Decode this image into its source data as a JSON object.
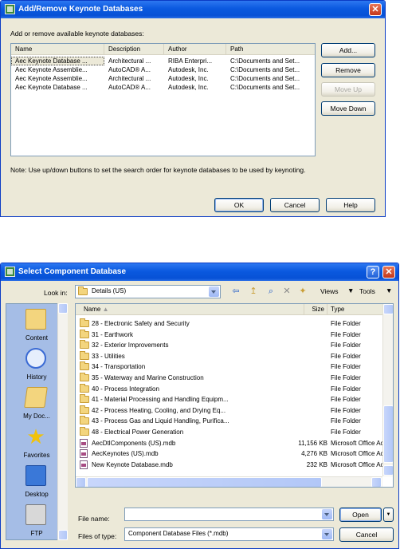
{
  "dialog1": {
    "title": "Add/Remove Keynote Databases",
    "instruction": "Add or remove available keynote databases:",
    "columns": [
      "Name",
      "Description",
      "Author",
      "Path"
    ],
    "rows": [
      [
        "Aec Keynote Database ...",
        "Architectural ...",
        "RIBA Enterpri...",
        "C:\\Documents and Set..."
      ],
      [
        "Aec Keynote Assemblie...",
        "AutoCAD® A...",
        "Autodesk, Inc.",
        "C:\\Documents and Set..."
      ],
      [
        "Aec Keynote Assemblie...",
        "Architectural ...",
        "Autodesk, Inc.",
        "C:\\Documents and Set..."
      ],
      [
        "Aec Keynote Database ...",
        "AutoCAD® A...",
        "Autodesk, Inc.",
        "C:\\Documents and Set..."
      ]
    ],
    "buttons": {
      "add": "Add...",
      "remove": "Remove",
      "move_up": "Move Up",
      "move_down": "Move Down",
      "ok": "OK",
      "cancel": "Cancel",
      "help": "Help"
    },
    "note": "Note: Use up/down buttons to set the search order for keynote databases to be used by keynoting."
  },
  "dialog2": {
    "title": "Select Component Database",
    "look_in_label": "Look in:",
    "look_in_value": "Details (US)",
    "views_label": "Views",
    "tools_label": "Tools",
    "places": [
      "Content",
      "History",
      "My Doc...",
      "Favorites",
      "Desktop",
      "FTP"
    ],
    "columns": [
      "Name",
      "Size",
      "Type"
    ],
    "files": [
      {
        "name": "28 - Electronic Safety and Security",
        "size": "",
        "type": "File Folder",
        "kind": "folder"
      },
      {
        "name": "31 - Earthwork",
        "size": "",
        "type": "File Folder",
        "kind": "folder"
      },
      {
        "name": "32 - Exterior Improvements",
        "size": "",
        "type": "File Folder",
        "kind": "folder"
      },
      {
        "name": "33 - Utilities",
        "size": "",
        "type": "File Folder",
        "kind": "folder"
      },
      {
        "name": "34 - Transportation",
        "size": "",
        "type": "File Folder",
        "kind": "folder"
      },
      {
        "name": "35 - Waterway and Marine Construction",
        "size": "",
        "type": "File Folder",
        "kind": "folder"
      },
      {
        "name": "40 - Process Integration",
        "size": "",
        "type": "File Folder",
        "kind": "folder"
      },
      {
        "name": "41 - Material Processing and Handling Equipm...",
        "size": "",
        "type": "File Folder",
        "kind": "folder"
      },
      {
        "name": "42 - Process Heating, Cooling, and Drying Eq...",
        "size": "",
        "type": "File Folder",
        "kind": "folder"
      },
      {
        "name": "43 - Process Gas and Liquid Handling, Purifica...",
        "size": "",
        "type": "File Folder",
        "kind": "folder"
      },
      {
        "name": "48 - Electrical Power Generation",
        "size": "",
        "type": "File Folder",
        "kind": "folder"
      },
      {
        "name": "AecDtlComponents (US).mdb",
        "size": "11,156 KB",
        "type": "Microsoft Office Acc...",
        "kind": "mdb"
      },
      {
        "name": "AecKeynotes (US).mdb",
        "size": "4,276 KB",
        "type": "Microsoft Office Acc...",
        "kind": "mdb"
      },
      {
        "name": "New Keynote Database.mdb",
        "size": "232 KB",
        "type": "Microsoft Office Acc...",
        "kind": "mdb"
      }
    ],
    "file_name_label": "File name:",
    "file_name_value": "",
    "files_of_type_label": "Files of type:",
    "files_of_type_value": "Component Database Files (*.mdb)",
    "open_label": "Open",
    "cancel_label": "Cancel"
  }
}
